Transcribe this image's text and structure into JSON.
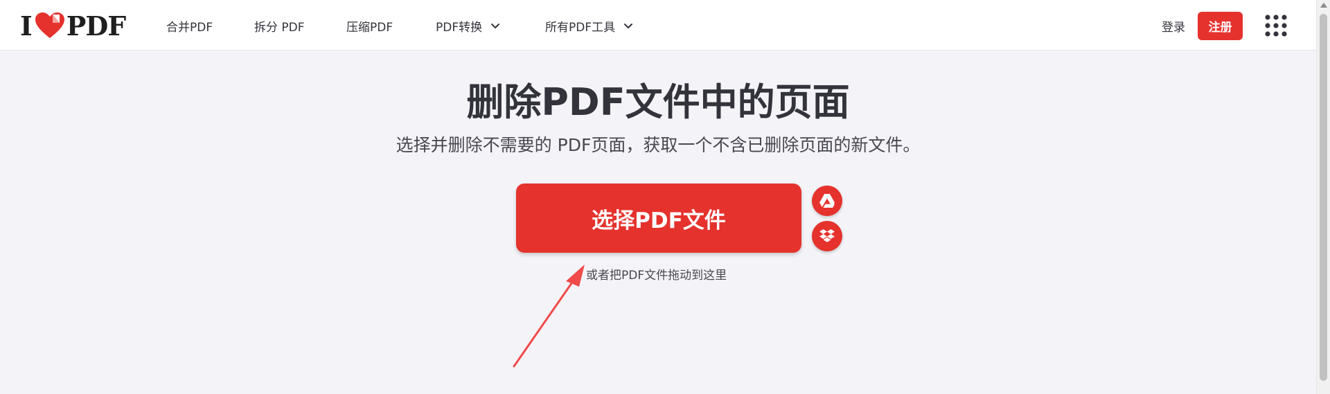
{
  "header": {
    "logo": {
      "left": "I",
      "right": "PDF"
    },
    "nav": [
      {
        "label": "合并PDF",
        "has_dropdown": false
      },
      {
        "label": "拆分 PDF",
        "has_dropdown": false
      },
      {
        "label": "压缩PDF",
        "has_dropdown": false
      },
      {
        "label": "PDF转换",
        "has_dropdown": true
      },
      {
        "label": "所有PDF工具",
        "has_dropdown": true
      }
    ],
    "login_label": "登录",
    "signup_label": "注册"
  },
  "main": {
    "title": "删除PDF文件中的页面",
    "subtitle": "选择并删除不需要的 PDF页面，获取一个不含已删除页面的新文件。",
    "select_button_label": "选择PDF文件",
    "drop_hint": "或者把PDF文件拖动到这里",
    "cloud_sources": [
      {
        "name": "google-drive",
        "icon": "google-drive-icon"
      },
      {
        "name": "dropbox",
        "icon": "dropbox-icon"
      }
    ]
  },
  "colors": {
    "brand_red": "#e5322d",
    "annotation_arrow": "#f04a4a",
    "text_dark": "#33333b",
    "background": "#f4f4f8"
  }
}
